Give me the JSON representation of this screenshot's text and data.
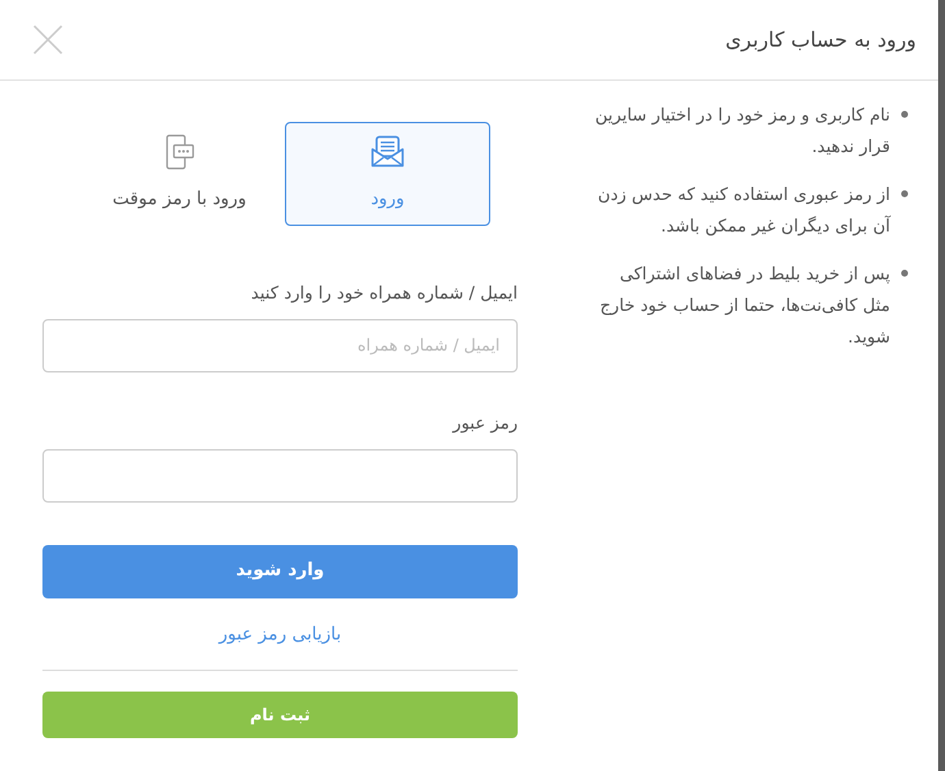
{
  "dialog": {
    "title": "ورود به حساب کاربری"
  },
  "tips": [
    "نام کاربری و رمز خود را در اختیار سایرین قرار ندهید.",
    "از رمز عبوری استفاده کنید که حدس زدن آن برای دیگران غیر ممکن باشد.",
    "پس از خرید بلیط در فضاهای اشتراکی مثل کافی‌نت‌ها، حتما از حساب خود خارج شوید."
  ],
  "tabs": [
    {
      "label": "ورود",
      "kind": "envelope",
      "selected": true
    },
    {
      "label": "ورود با رمز موقت",
      "kind": "phone",
      "selected": false
    }
  ],
  "fields": [
    {
      "label": "ایمیل / شماره همراه خود را وارد کنید",
      "placeholder": "ایمیل / شماره همراه"
    },
    {
      "label": "رمز عبور"
    }
  ],
  "login_button": "وارد شوید",
  "forgot_link": "بازیابی رمز عبور",
  "register_button": "ثبت نام"
}
